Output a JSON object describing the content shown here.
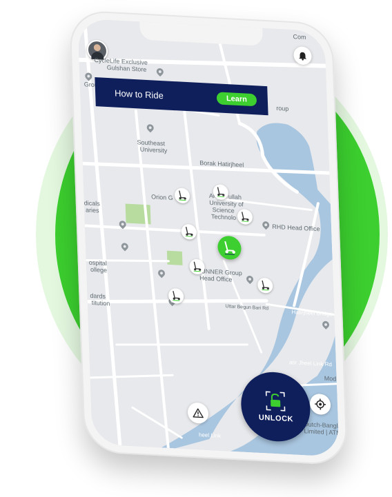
{
  "colors": {
    "accent": "#3ccf2f",
    "navy": "#0f1f5c",
    "water": "#a9c6e0",
    "park": "#b8dca0",
    "map_bg": "#e8e9ec",
    "road": "#ffffff"
  },
  "header": {
    "avatar_icon": "user-avatar-icon",
    "bell_icon": "bell-icon"
  },
  "banner": {
    "title": "How to Ride",
    "learn_label": "Learn"
  },
  "map_labels": {
    "cyclelife": "CycleLife Exclusive",
    "gulshan_store": "Gulshan Store",
    "group_left": "Group",
    "com_top": "Com",
    "group_right": "roup",
    "southeast": "Southeast",
    "university": "University",
    "borak": "Borak Hatirjheel",
    "orion": "Orion G",
    "ahsanullah1": "Ah",
    "ahsanullah2": "ullah",
    "univ_of": "University of",
    "science": "Science",
    "technology": "Technolo",
    "rhd": "RHD Head Office",
    "medicals": "dicals",
    "aries": "aries",
    "hospital": "ospital",
    "college": "ollege",
    "runner1": "RUNNER Group",
    "runner2": "Head Office",
    "standards": "dards",
    "institution": "titution",
    "road1": "Uttar Begun Bari Rd",
    "hatirjheel_bridge": "Hatirjheel Bridge",
    "link_rd": "atir Jheel Link Rd",
    "dutch1": "Dutch-Bangla Ba",
    "dutch2": "Limited | ATM Bo",
    "moda": "Mod",
    "link_rd2": "heel Link"
  },
  "controls": {
    "unlock_label": "UNLOCK",
    "warning_icon": "warning-icon",
    "locate_icon": "locate-icon",
    "lock_icon": "padlock-open-icon"
  }
}
